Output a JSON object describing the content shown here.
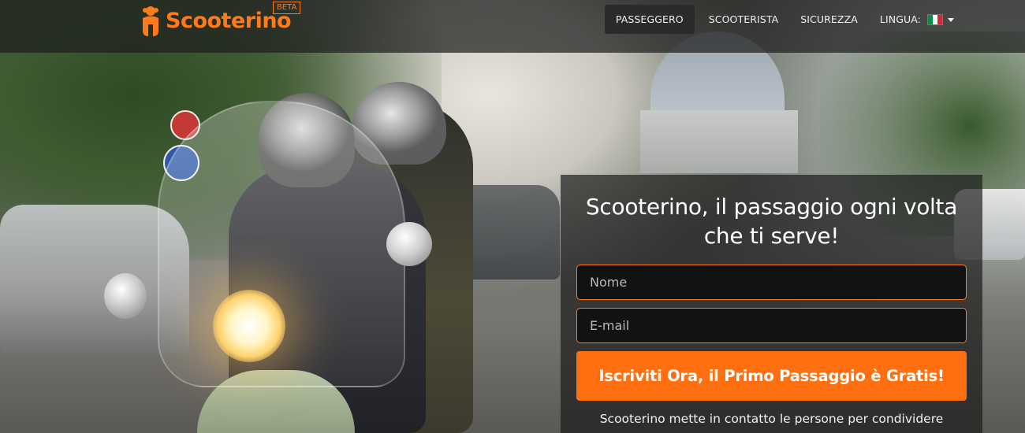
{
  "brand": {
    "name": "Scooterino",
    "badge": "BETA",
    "color": "#ff7a1a"
  },
  "nav": {
    "items": [
      {
        "label": "PASSEGGERO",
        "active": true
      },
      {
        "label": "SCOOTERISTA",
        "active": false
      },
      {
        "label": "SICUREZZA",
        "active": false
      }
    ],
    "language": {
      "label": "LINGUA:",
      "flag": "italian-flag-icon",
      "flag_colors": [
        "#009246",
        "#ffffff",
        "#ce2b37"
      ]
    }
  },
  "signup": {
    "headline": "Scooterino, il passaggio ogni volta che ti serve!",
    "name_placeholder": "Nome",
    "email_placeholder": "E-mail",
    "cta_label": "Iscriviti Ora, il Primo Passaggio è Gratis!",
    "description": "Scooterino mette in contatto le persone per condividere"
  },
  "colors": {
    "accent": "#ff6f0f",
    "navbar_bg": "rgba(30,30,30,0.72)",
    "panel_bg": "rgba(25,25,25,0.68)"
  }
}
